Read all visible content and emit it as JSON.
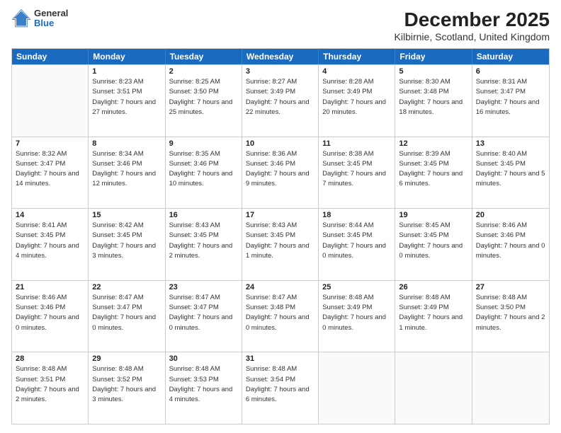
{
  "logo": {
    "general": "General",
    "blue": "Blue"
  },
  "title": "December 2025",
  "subtitle": "Kilbirnie, Scotland, United Kingdom",
  "days_of_week": [
    "Sunday",
    "Monday",
    "Tuesday",
    "Wednesday",
    "Thursday",
    "Friday",
    "Saturday"
  ],
  "weeks": [
    [
      {
        "day": "",
        "sunrise": "",
        "sunset": "",
        "daylight": ""
      },
      {
        "day": "1",
        "sunrise": "Sunrise: 8:23 AM",
        "sunset": "Sunset: 3:51 PM",
        "daylight": "Daylight: 7 hours and 27 minutes."
      },
      {
        "day": "2",
        "sunrise": "Sunrise: 8:25 AM",
        "sunset": "Sunset: 3:50 PM",
        "daylight": "Daylight: 7 hours and 25 minutes."
      },
      {
        "day": "3",
        "sunrise": "Sunrise: 8:27 AM",
        "sunset": "Sunset: 3:49 PM",
        "daylight": "Daylight: 7 hours and 22 minutes."
      },
      {
        "day": "4",
        "sunrise": "Sunrise: 8:28 AM",
        "sunset": "Sunset: 3:49 PM",
        "daylight": "Daylight: 7 hours and 20 minutes."
      },
      {
        "day": "5",
        "sunrise": "Sunrise: 8:30 AM",
        "sunset": "Sunset: 3:48 PM",
        "daylight": "Daylight: 7 hours and 18 minutes."
      },
      {
        "day": "6",
        "sunrise": "Sunrise: 8:31 AM",
        "sunset": "Sunset: 3:47 PM",
        "daylight": "Daylight: 7 hours and 16 minutes."
      }
    ],
    [
      {
        "day": "7",
        "sunrise": "Sunrise: 8:32 AM",
        "sunset": "Sunset: 3:47 PM",
        "daylight": "Daylight: 7 hours and 14 minutes."
      },
      {
        "day": "8",
        "sunrise": "Sunrise: 8:34 AM",
        "sunset": "Sunset: 3:46 PM",
        "daylight": "Daylight: 7 hours and 12 minutes."
      },
      {
        "day": "9",
        "sunrise": "Sunrise: 8:35 AM",
        "sunset": "Sunset: 3:46 PM",
        "daylight": "Daylight: 7 hours and 10 minutes."
      },
      {
        "day": "10",
        "sunrise": "Sunrise: 8:36 AM",
        "sunset": "Sunset: 3:46 PM",
        "daylight": "Daylight: 7 hours and 9 minutes."
      },
      {
        "day": "11",
        "sunrise": "Sunrise: 8:38 AM",
        "sunset": "Sunset: 3:45 PM",
        "daylight": "Daylight: 7 hours and 7 minutes."
      },
      {
        "day": "12",
        "sunrise": "Sunrise: 8:39 AM",
        "sunset": "Sunset: 3:45 PM",
        "daylight": "Daylight: 7 hours and 6 minutes."
      },
      {
        "day": "13",
        "sunrise": "Sunrise: 8:40 AM",
        "sunset": "Sunset: 3:45 PM",
        "daylight": "Daylight: 7 hours and 5 minutes."
      }
    ],
    [
      {
        "day": "14",
        "sunrise": "Sunrise: 8:41 AM",
        "sunset": "Sunset: 3:45 PM",
        "daylight": "Daylight: 7 hours and 4 minutes."
      },
      {
        "day": "15",
        "sunrise": "Sunrise: 8:42 AM",
        "sunset": "Sunset: 3:45 PM",
        "daylight": "Daylight: 7 hours and 3 minutes."
      },
      {
        "day": "16",
        "sunrise": "Sunrise: 8:43 AM",
        "sunset": "Sunset: 3:45 PM",
        "daylight": "Daylight: 7 hours and 2 minutes."
      },
      {
        "day": "17",
        "sunrise": "Sunrise: 8:43 AM",
        "sunset": "Sunset: 3:45 PM",
        "daylight": "Daylight: 7 hours and 1 minute."
      },
      {
        "day": "18",
        "sunrise": "Sunrise: 8:44 AM",
        "sunset": "Sunset: 3:45 PM",
        "daylight": "Daylight: 7 hours and 0 minutes."
      },
      {
        "day": "19",
        "sunrise": "Sunrise: 8:45 AM",
        "sunset": "Sunset: 3:45 PM",
        "daylight": "Daylight: 7 hours and 0 minutes."
      },
      {
        "day": "20",
        "sunrise": "Sunrise: 8:46 AM",
        "sunset": "Sunset: 3:46 PM",
        "daylight": "Daylight: 7 hours and 0 minutes."
      }
    ],
    [
      {
        "day": "21",
        "sunrise": "Sunrise: 8:46 AM",
        "sunset": "Sunset: 3:46 PM",
        "daylight": "Daylight: 7 hours and 0 minutes."
      },
      {
        "day": "22",
        "sunrise": "Sunrise: 8:47 AM",
        "sunset": "Sunset: 3:47 PM",
        "daylight": "Daylight: 7 hours and 0 minutes."
      },
      {
        "day": "23",
        "sunrise": "Sunrise: 8:47 AM",
        "sunset": "Sunset: 3:47 PM",
        "daylight": "Daylight: 7 hours and 0 minutes."
      },
      {
        "day": "24",
        "sunrise": "Sunrise: 8:47 AM",
        "sunset": "Sunset: 3:48 PM",
        "daylight": "Daylight: 7 hours and 0 minutes."
      },
      {
        "day": "25",
        "sunrise": "Sunrise: 8:48 AM",
        "sunset": "Sunset: 3:49 PM",
        "daylight": "Daylight: 7 hours and 0 minutes."
      },
      {
        "day": "26",
        "sunrise": "Sunrise: 8:48 AM",
        "sunset": "Sunset: 3:49 PM",
        "daylight": "Daylight: 7 hours and 1 minute."
      },
      {
        "day": "27",
        "sunrise": "Sunrise: 8:48 AM",
        "sunset": "Sunset: 3:50 PM",
        "daylight": "Daylight: 7 hours and 2 minutes."
      }
    ],
    [
      {
        "day": "28",
        "sunrise": "Sunrise: 8:48 AM",
        "sunset": "Sunset: 3:51 PM",
        "daylight": "Daylight: 7 hours and 2 minutes."
      },
      {
        "day": "29",
        "sunrise": "Sunrise: 8:48 AM",
        "sunset": "Sunset: 3:52 PM",
        "daylight": "Daylight: 7 hours and 3 minutes."
      },
      {
        "day": "30",
        "sunrise": "Sunrise: 8:48 AM",
        "sunset": "Sunset: 3:53 PM",
        "daylight": "Daylight: 7 hours and 4 minutes."
      },
      {
        "day": "31",
        "sunrise": "Sunrise: 8:48 AM",
        "sunset": "Sunset: 3:54 PM",
        "daylight": "Daylight: 7 hours and 6 minutes."
      },
      {
        "day": "",
        "sunrise": "",
        "sunset": "",
        "daylight": ""
      },
      {
        "day": "",
        "sunrise": "",
        "sunset": "",
        "daylight": ""
      },
      {
        "day": "",
        "sunrise": "",
        "sunset": "",
        "daylight": ""
      }
    ]
  ]
}
